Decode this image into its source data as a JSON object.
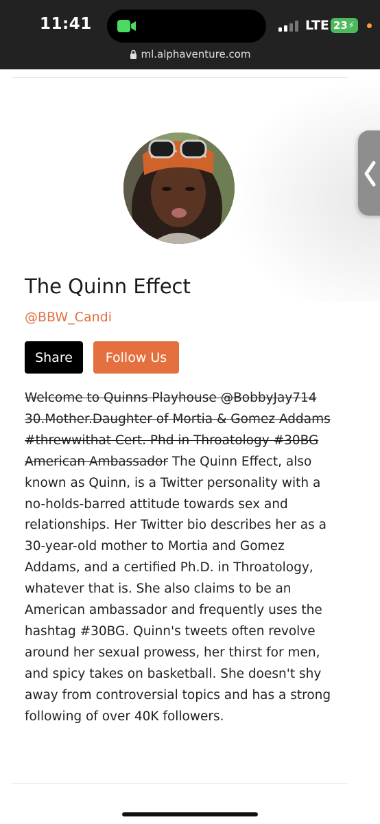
{
  "status_bar": {
    "time": "11:41",
    "network": "LTE",
    "battery": "23",
    "url": "ml.alphaventure.com",
    "icons": [
      "facetime-camera-icon",
      "signal-bars-icon",
      "lock-icon",
      "battery-charging-icon"
    ],
    "camera_color": "#4cd964"
  },
  "profile": {
    "avatar_icon": "profile-photo",
    "name": "The Quinn Effect",
    "handle": "@BBW_Candi",
    "share_label": "Share",
    "follow_label": "Follow Us",
    "accent": "#e5703f"
  },
  "bio": {
    "struck_text": "Welcome to Quinns Playhouse @BobbyJay714 30.Mother.Daughter of Mortia & Gomez Addams #threwwithat Cert. Phd in Throatology #30BG American Ambassador",
    "text": "The Quinn Effect, also known as Quinn, is a Twitter personality with a no-holds-barred attitude towards sex and relationships. Her Twitter bio describes her as a 30-year-old mother to Mortia and Gomez Addams, and a certified Ph.D. in Throatology, whatever that is. She also claims to be an American ambassador and frequently uses the hashtag #30BG. Quinn's tweets often revolve around her sexual prowess, her thirst for men, and spicy takes on basketball. She doesn't shy away from controversial topics and has a strong following of over 40K followers."
  },
  "side_tab": {
    "icon": "chevron-left-icon"
  }
}
